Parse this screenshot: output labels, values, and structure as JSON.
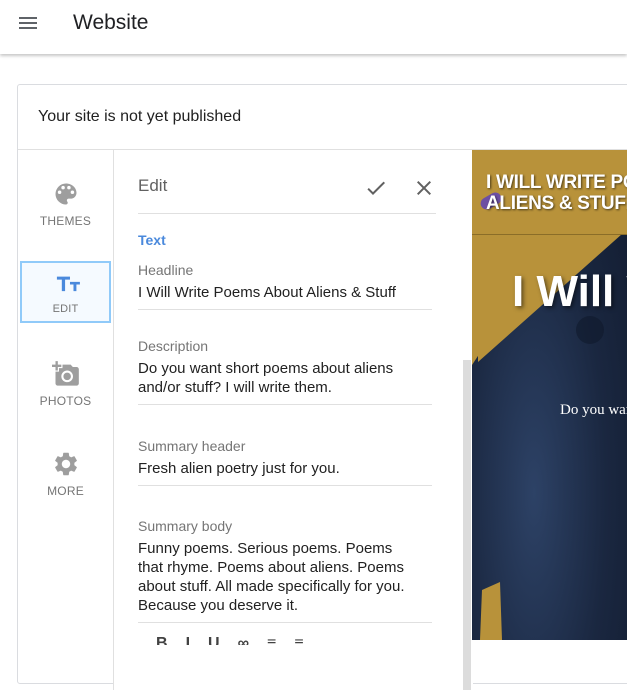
{
  "app": {
    "title": "Website"
  },
  "status": {
    "text": "Your site is not yet published"
  },
  "rail": {
    "items": [
      {
        "label": "THEMES",
        "icon": "palette-icon"
      },
      {
        "label": "EDIT",
        "icon": "text-format-icon"
      },
      {
        "label": "PHOTOS",
        "icon": "add-photo-icon"
      },
      {
        "label": "MORE",
        "icon": "gear-icon"
      }
    ]
  },
  "edit": {
    "title": "Edit",
    "section": "Text",
    "fields": [
      {
        "label": "Headline",
        "value": "I Will Write Poems About Aliens & Stuff"
      },
      {
        "label": "Description",
        "value": "Do you want short poems about aliens\nand/or stuff? I will write them."
      },
      {
        "label": "Summary header",
        "value": "Fresh alien poetry just for you."
      },
      {
        "label": "Summary body",
        "value": "Funny poems. Serious poems. Poems\nthat rhyme. Poems about aliens. Poems\nabout stuff. All made specifically for you.\nBecause you deserve it."
      }
    ]
  },
  "preview": {
    "site_name": "I WILL WRITE POEMS\nALIENS & STUFF",
    "hero_title": "I Will Write",
    "description": "Do you want short poems"
  },
  "colors": {
    "accent": "#4a89dc",
    "header_gold": "#b8923a",
    "sky": "#1b2a44"
  }
}
